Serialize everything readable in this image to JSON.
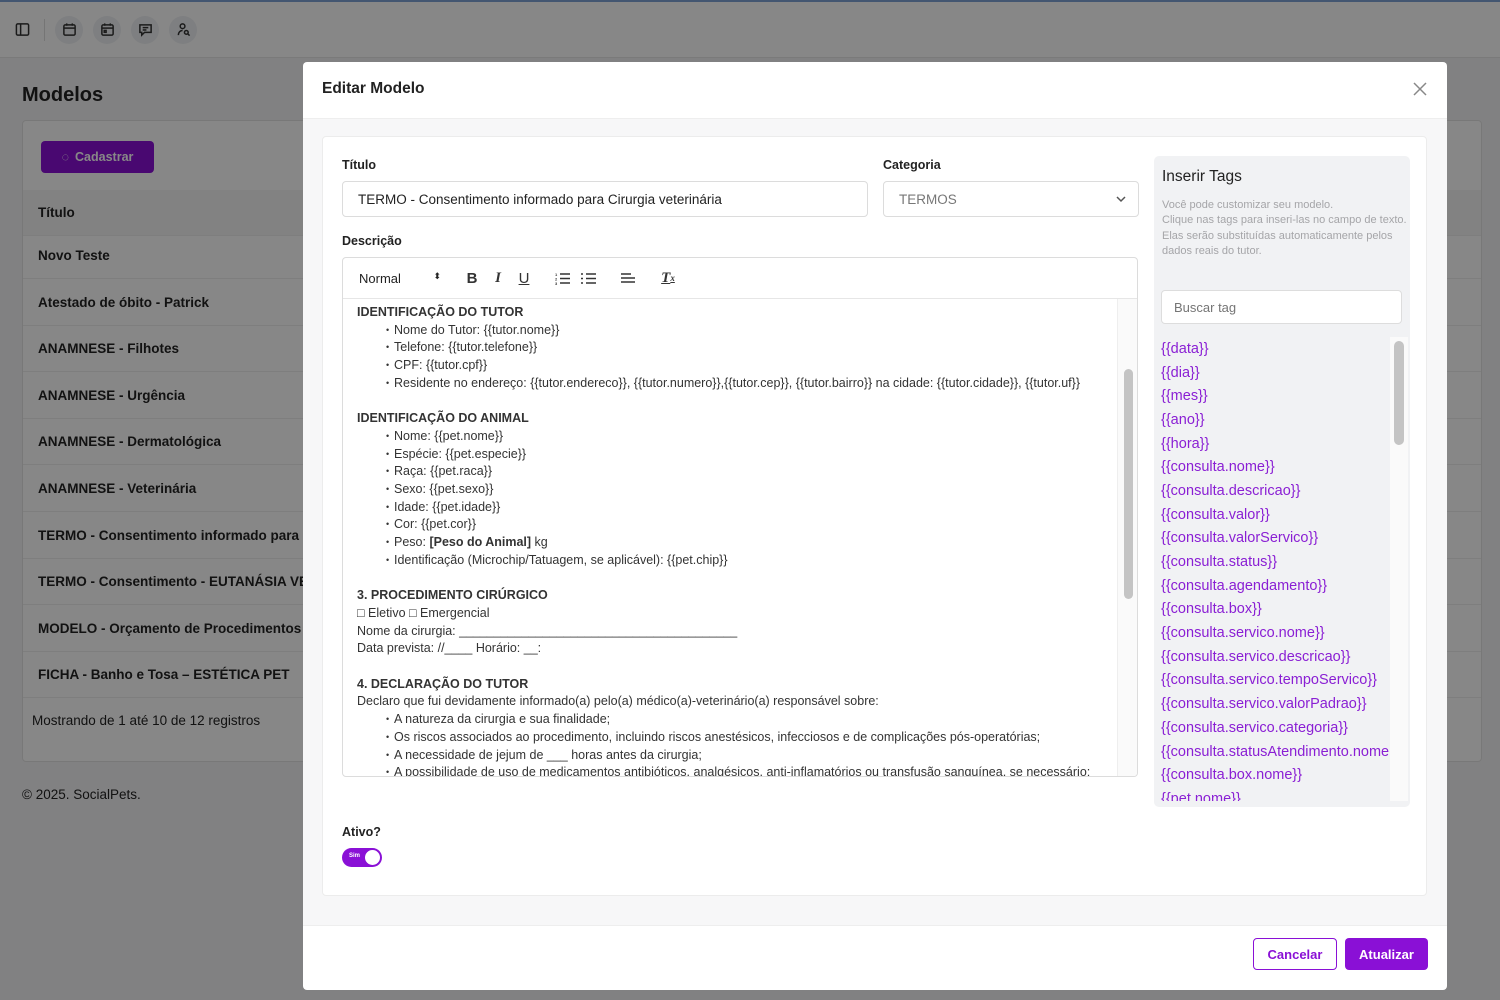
{
  "topbar": {
    "icons": [
      "sidebar-toggle-icon",
      "calendar-icon",
      "calendar-icon",
      "chat-icon",
      "user-search-icon"
    ]
  },
  "page": {
    "title": "Modelos",
    "register_label": "Cadastrar",
    "table_header": "Título",
    "rows": [
      "Novo Teste",
      "Atestado de óbito - Patrick",
      "ANAMNESE - Filhotes",
      "ANAMNESE - Urgência",
      "ANAMNESE - Dermatológica",
      "ANAMNESE - Veterinária",
      "TERMO - Consentimento informado para Cirurgia veterinária",
      "TERMO - Consentimento - EUTANÁSIA VETERINÁRIA",
      "MODELO - Orçamento de Procedimentos",
      "FICHA - Banho e Tosa – ESTÉTICA PET"
    ],
    "pagination": "Mostrando de 1 até 10 de 12 registros",
    "copyright": "© 2025. SocialPets."
  },
  "modal": {
    "title": "Editar Modelo",
    "titulo_label": "Título",
    "titulo_value": "TERMO -  Consentimento informado para Cirurgia veterinária",
    "categoria_label": "Categoria",
    "categoria_value": "TERMOS",
    "descricao_label": "Descrição",
    "toolbar": {
      "format": "Normal",
      "bold": "B",
      "italic": "I",
      "underline": "U"
    },
    "content": [
      {
        "type": "h",
        "text": "IDENTIFICAÇÃO DO TUTOR"
      },
      {
        "type": "li",
        "text": "Nome do Tutor: {{tutor.nome}}"
      },
      {
        "type": "li",
        "text": "Telefone: {{tutor.telefone}}"
      },
      {
        "type": "li",
        "text": "CPF: {{tutor.cpf}}"
      },
      {
        "type": "li",
        "text": "Residente no endereço: {{tutor.endereco}}, {{tutor.numero}},{{tutor.cep}}, {{tutor.bairro}} na cidade: {{tutor.cidade}}, {{tutor.uf}}"
      },
      {
        "type": "gap"
      },
      {
        "type": "h",
        "text": "IDENTIFICAÇÃO DO ANIMAL"
      },
      {
        "type": "li",
        "text": "Nome: {{pet.nome}}"
      },
      {
        "type": "li",
        "text": "Espécie: {{pet.especie}}"
      },
      {
        "type": "li",
        "text": "Raça: {{pet.raca}}"
      },
      {
        "type": "li",
        "text": "Sexo: {{pet.sexo}}"
      },
      {
        "type": "li",
        "text": "Idade: {{pet.idade}}"
      },
      {
        "type": "li",
        "text": "Cor: {{pet.cor}}"
      },
      {
        "type": "li",
        "text": "Peso: ",
        "bold": "[Peso do Animal]",
        "after": " kg"
      },
      {
        "type": "li",
        "text": "Identificação (Microchip/Tatuagem, se aplicável): {{pet.chip}}"
      },
      {
        "type": "gap"
      },
      {
        "type": "h",
        "text": "3. PROCEDIMENTO CIRÚRGICO"
      },
      {
        "type": "p",
        "text": "□ Eletivo □ Emergencial"
      },
      {
        "type": "p",
        "text": "Nome da cirurgia: ________________________________________"
      },
      {
        "type": "p",
        "text": "Data prevista: //____ Horário: __:"
      },
      {
        "type": "gap"
      },
      {
        "type": "h",
        "text": "4. DECLARAÇÃO DO TUTOR"
      },
      {
        "type": "p",
        "text": "Declaro que fui devidamente informado(a) pelo(a) médico(a)-veterinário(a) responsável sobre:"
      },
      {
        "type": "li",
        "text": "A natureza da cirurgia e sua finalidade;"
      },
      {
        "type": "li",
        "text": "Os riscos associados ao procedimento, incluindo riscos anestésicos, infecciosos e de complicações pós-operatórias;"
      },
      {
        "type": "li",
        "text": "A necessidade de jejum de ___ horas antes da cirurgia;"
      },
      {
        "type": "li",
        "text": "A possibilidade de uso de medicamentos antibióticos, analgésicos, anti-inflamatórios ou transfusão sanguínea, se necessário;"
      }
    ],
    "tags": {
      "title": "Inserir Tags",
      "desc": [
        "Você pode customizar seu modelo.",
        "Clique nas tags para inseri-las no campo de texto.",
        "Elas serão substituídas automaticamente pelos dados reais do tutor."
      ],
      "search_placeholder": "Buscar tag",
      "items": [
        "{{data}}",
        "{{dia}}",
        "{{mes}}",
        "{{ano}}",
        "{{hora}}",
        "{{consulta.nome}}",
        "{{consulta.descricao}}",
        "{{consulta.valor}}",
        "{{consulta.valorServico}}",
        "{{consulta.status}}",
        "{{consulta.agendamento}}",
        "{{consulta.box}}",
        "{{consulta.servico.nome}}",
        "{{consulta.servico.descricao}}",
        "{{consulta.servico.tempoServico}}",
        "{{consulta.servico.valorPadrao}}",
        "{{consulta.servico.categoria}}",
        "{{consulta.statusAtendimento.nome}}",
        "{{consulta.box.nome}}",
        "{{pet.nome}}"
      ]
    },
    "ativo_label": "Ativo?",
    "ativo_toggle": "Sim",
    "ativo_value": true,
    "cancel_label": "Cancelar",
    "save_label": "Atualizar"
  },
  "colors": {
    "accent": "#8a10d6"
  }
}
